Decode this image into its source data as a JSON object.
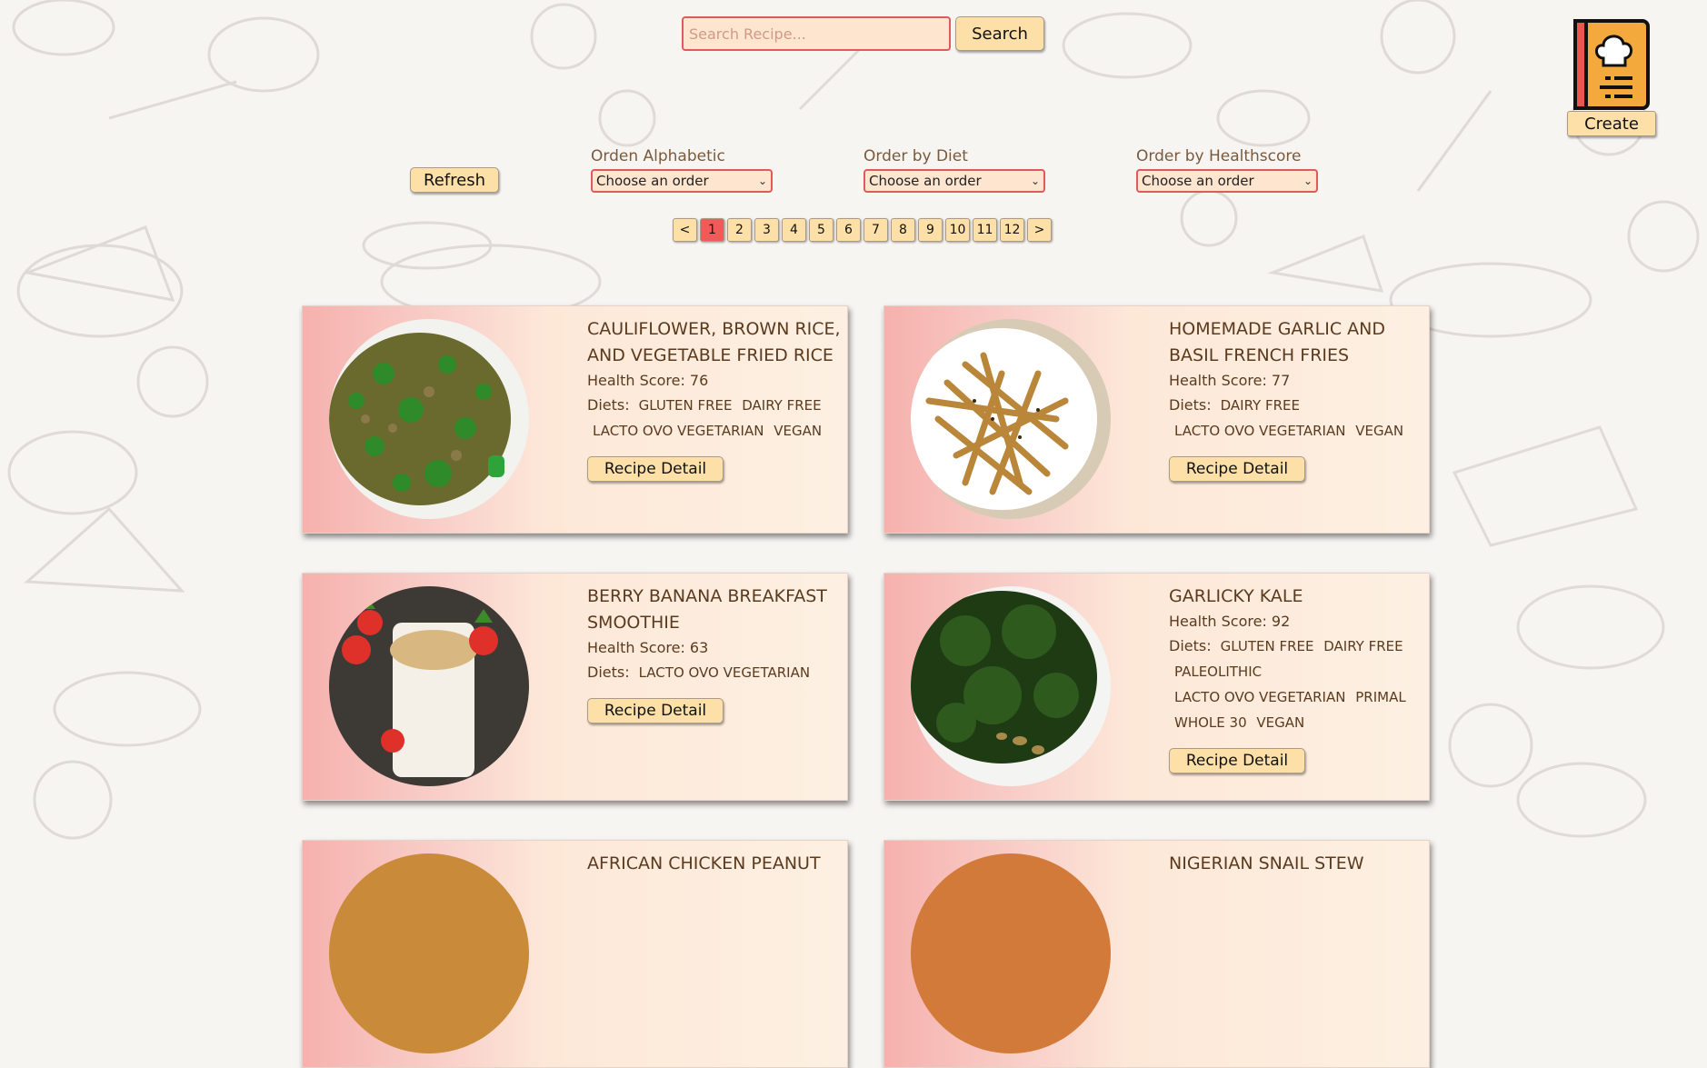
{
  "search": {
    "placeholder": "Search Recipe...",
    "button_label": "Search"
  },
  "create": {
    "button_label": "Create",
    "icon": "recipe-book-chef-hat-icon"
  },
  "filters": {
    "refresh_label": "Refresh",
    "alphabetic": {
      "label": "Orden Alphabetic",
      "value": "Choose an order"
    },
    "diet": {
      "label": "Order by Diet",
      "value": "Choose an order"
    },
    "healthscore": {
      "label": "Order by Healthscore",
      "value": "Choose an order"
    }
  },
  "pagination": {
    "prev": "<",
    "next": ">",
    "pages": [
      "1",
      "2",
      "3",
      "4",
      "5",
      "6",
      "7",
      "8",
      "9",
      "10",
      "11",
      "12"
    ],
    "current": "1"
  },
  "recipes": [
    {
      "title": "CAULIFLOWER, BROWN RICE, AND VEGETABLE FRIED RICE",
      "health_score": "Health Score: 76",
      "diets_label": "Diets:",
      "diets": [
        "GLUTEN FREE",
        "DAIRY FREE",
        "LACTO OVO VEGETARIAN",
        "VEGAN"
      ],
      "button": "Recipe Detail",
      "image": "fried-rice-photo"
    },
    {
      "title": "HOMEMADE GARLIC AND BASIL FRENCH FRIES",
      "health_score": "Health Score: 77",
      "diets_label": "Diets:",
      "diets": [
        "DAIRY FREE",
        "LACTO OVO VEGETARIAN",
        "VEGAN"
      ],
      "button": "Recipe Detail",
      "image": "french-fries-photo"
    },
    {
      "title": "BERRY BANANA BREAKFAST SMOOTHIE",
      "health_score": "Health Score: 63",
      "diets_label": "Diets:",
      "diets": [
        "LACTO OVO VEGETARIAN"
      ],
      "button": "Recipe Detail",
      "image": "smoothie-photo"
    },
    {
      "title": "GARLICKY KALE",
      "health_score": "Health Score: 92",
      "diets_label": "Diets:",
      "diets": [
        "GLUTEN FREE",
        "DAIRY FREE",
        "PALEOLITHIC",
        "LACTO OVO VEGETARIAN",
        "PRIMAL",
        "WHOLE 30",
        "VEGAN"
      ],
      "button": "Recipe Detail",
      "image": "kale-photo"
    },
    {
      "title": "AFRICAN CHICKEN PEANUT",
      "image": "chicken-peanut-photo"
    },
    {
      "title": "NIGERIAN SNAIL STEW",
      "image": "snail-stew-photo"
    }
  ],
  "colors": {
    "accent_red": "#e05a5a",
    "button_bg": "#fde0a8",
    "active_page": "#f25a5a",
    "card_text": "#5a3b1f"
  }
}
